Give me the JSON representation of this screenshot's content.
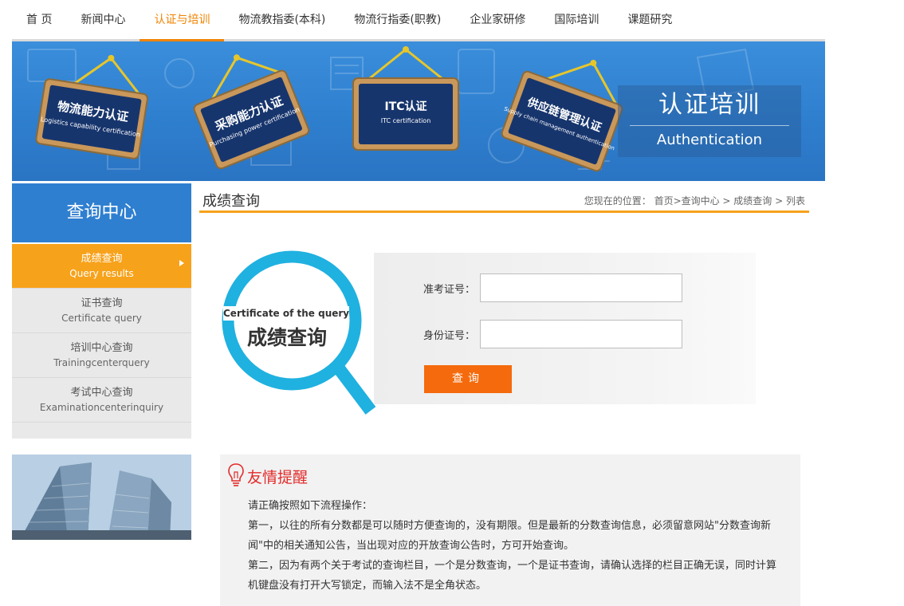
{
  "nav": {
    "items": [
      "首 页",
      "新闻中心",
      "认证与培训",
      "物流教指委(本科)",
      "物流行指委(职教)",
      "企业家研修",
      "国际培训",
      "课题研究"
    ]
  },
  "banner": {
    "title_cn": "认证培训",
    "title_en": "Authentication",
    "boards": [
      {
        "cn": "物流能力认证",
        "en": "Logistics capability certification"
      },
      {
        "cn": "采购能力认证",
        "en": "Purchasing power certification"
      },
      {
        "cn": "ITC认证",
        "en": "ITC certification"
      },
      {
        "cn": "供应链管理认证",
        "en": "Supply chain management authentication"
      }
    ]
  },
  "sidebar": {
    "title": "查询中心",
    "items": [
      {
        "cn": "成绩查询",
        "en": "Query results",
        "active": true
      },
      {
        "cn": "证书查询",
        "en": "Certificate query"
      },
      {
        "cn": "培训中心查询",
        "en": "Trainingcenterquery"
      },
      {
        "cn": "考试中心查询",
        "en": "Examinationcenterinquiry"
      }
    ]
  },
  "content": {
    "title": "成绩查询",
    "breadcrumb": "您现在的位置： 首页>查询中心 > 成绩查询 > 列表"
  },
  "query": {
    "graphic_en": "Certificate of the query",
    "graphic_cn": "成绩查询",
    "field1_label": "准考证号：",
    "field1_value": "",
    "field2_label": "身份证号：",
    "field2_value": "",
    "button_label": "查询"
  },
  "tips": {
    "title": "友情提醒",
    "lines": [
      "请正确按照如下流程操作：",
      "第一，以往的所有分数都是可以随时方便查询的，没有期限。但是最新的分数查询信息，必须留意网站\"分数查询新闻\"中的相关通知公告，当出现对应的开放查询公告时，方可开始查询。",
      "第二，因为有两个关于考试的查询栏目，一个是分数查询，一个是证书查询，请确认选择的栏目正确无误，同时计算机键盘没有打开大写锁定，而输入法不是全角状态。"
    ]
  },
  "colors": {
    "accent_orange": "#f08300",
    "sidebar_blue": "#2f7fd0",
    "button_orange": "#f56a0c",
    "tip_red": "#e32b2b"
  }
}
